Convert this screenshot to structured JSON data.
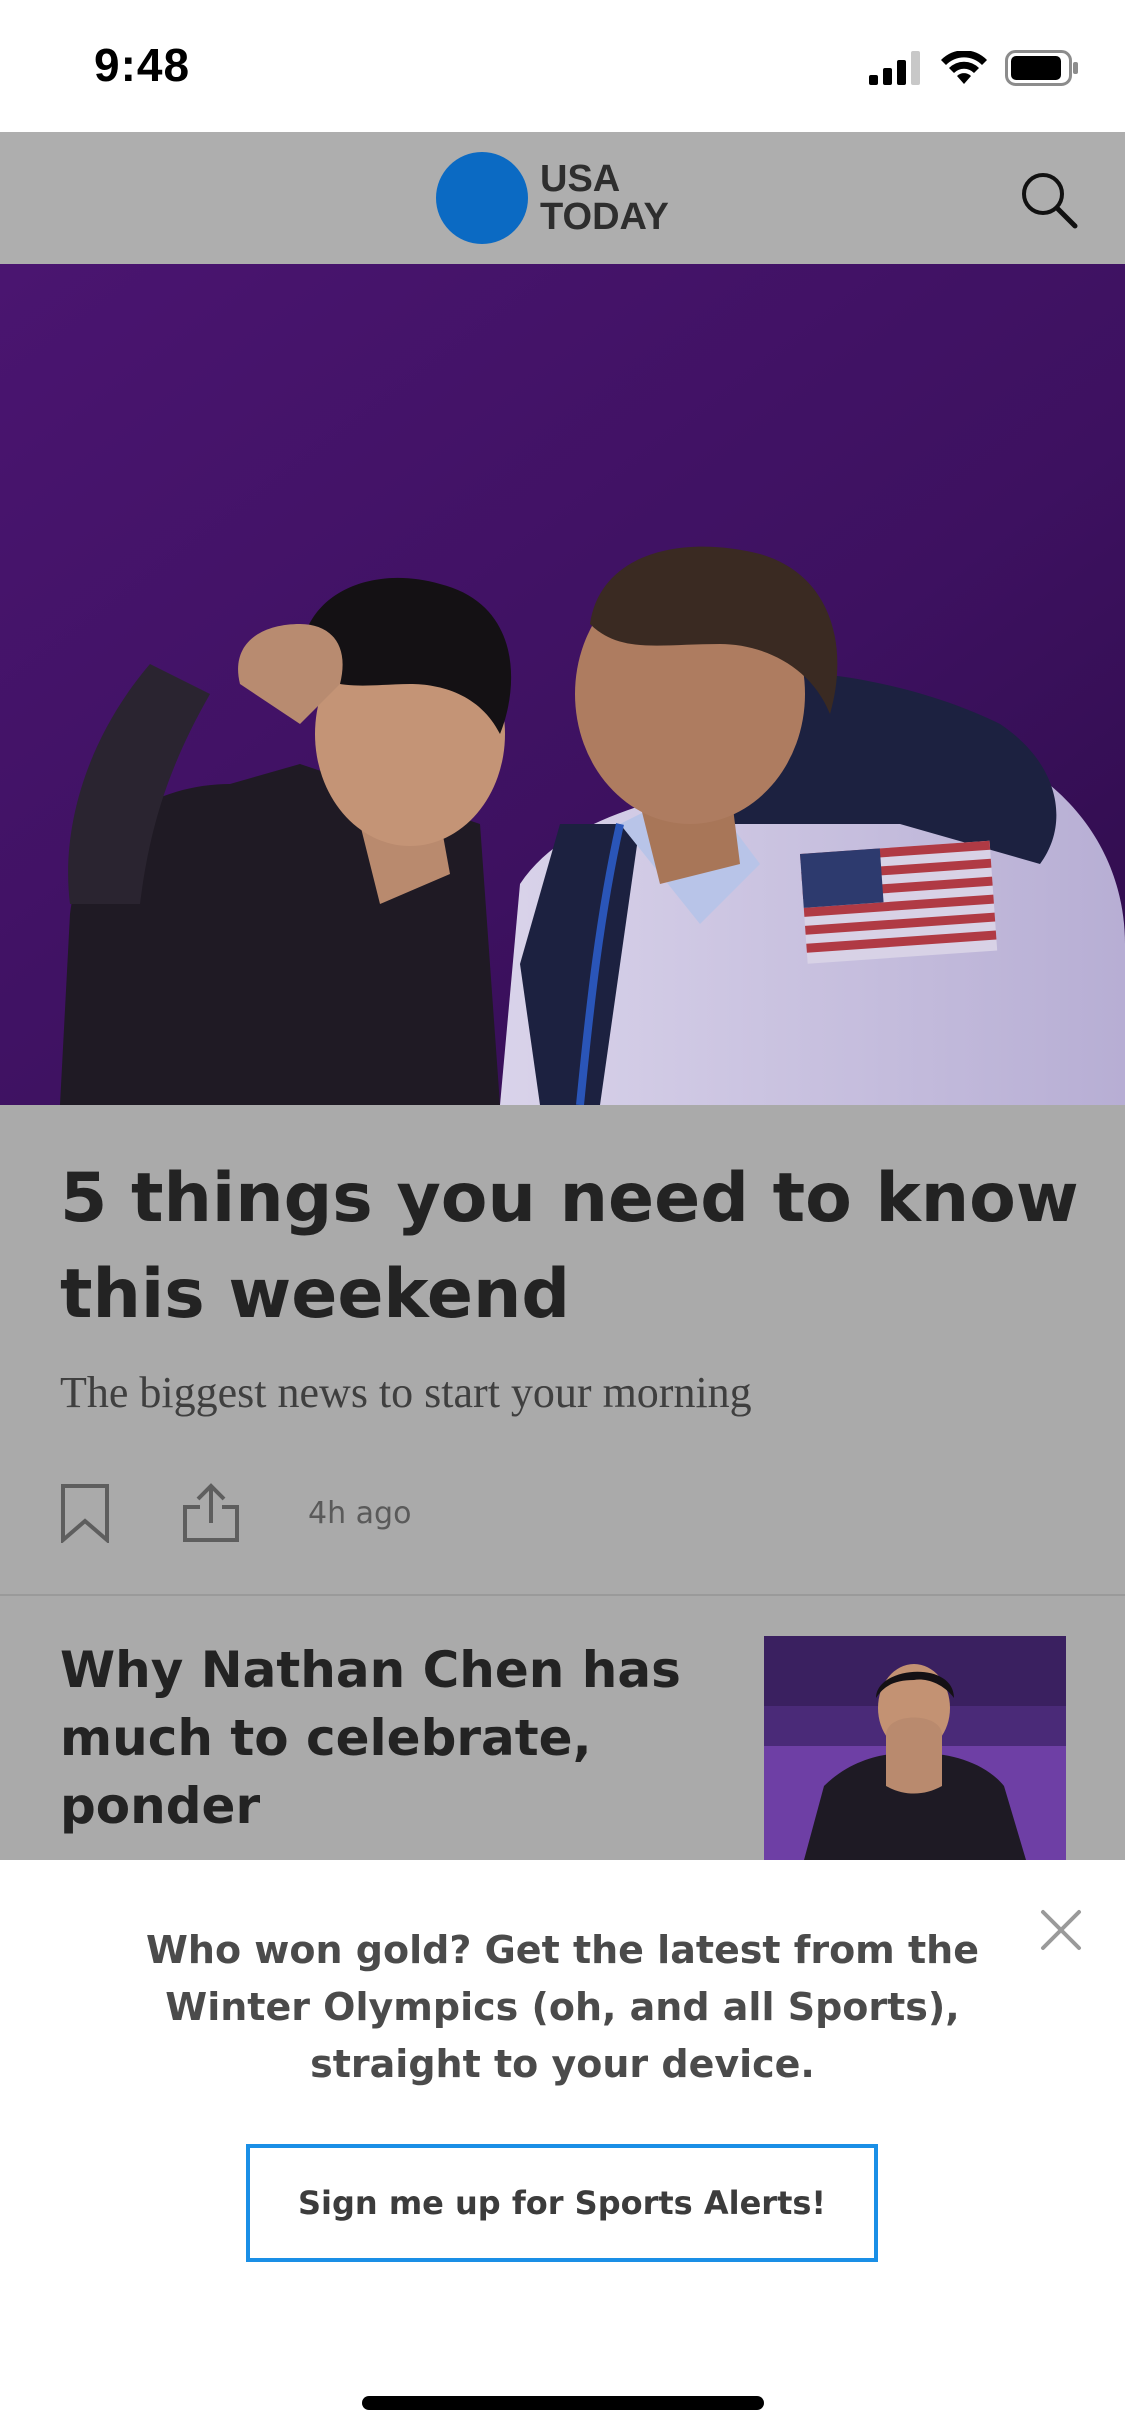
{
  "status_bar": {
    "time": "9:48"
  },
  "header": {
    "logo_line1": "USA",
    "logo_line2": "TODAY",
    "logo_color": "#0b6ac3",
    "search_icon": "search-icon"
  },
  "hero_article": {
    "headline": "5 things you need to know this weekend",
    "summary": "The biggest news to start your morning",
    "timestamp": "4h ago",
    "bookmark_icon": "bookmark-icon",
    "share_icon": "share-icon"
  },
  "articles": [
    {
      "headline": "Why Nathan Chen has much to celebrate, ponder"
    }
  ],
  "alert_sheet": {
    "message": "Who won gold? Get the latest from the Winter Olympics (oh, and all Sports), straight to your device.",
    "button_label": "Sign me up for Sports Alerts!",
    "button_border_color": "#1a8fe6",
    "close_icon": "close-icon"
  }
}
